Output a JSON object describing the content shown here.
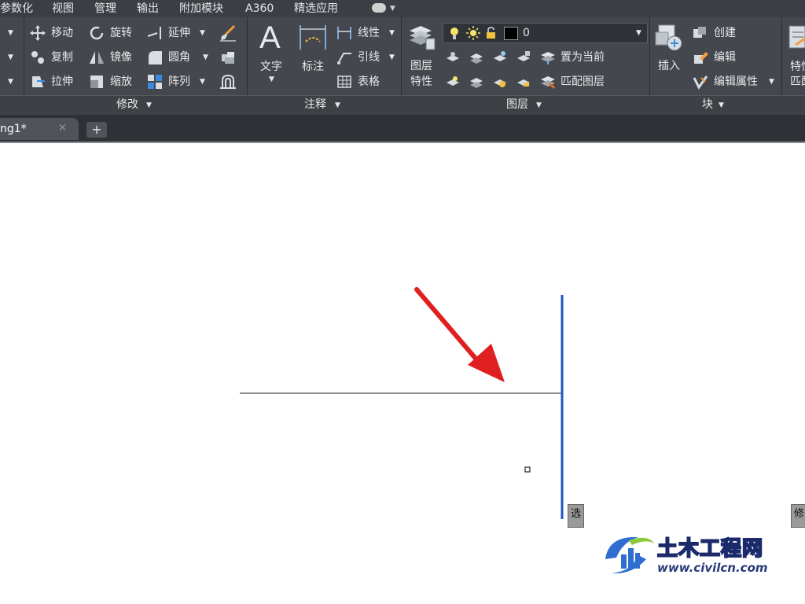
{
  "menu": {
    "items": [
      {
        "label": "参数化"
      },
      {
        "label": "视图"
      },
      {
        "label": "管理"
      },
      {
        "label": "输出"
      },
      {
        "label": "附加模块"
      },
      {
        "label": "A360"
      },
      {
        "label": "精选应用"
      }
    ]
  },
  "ribbon": {
    "modify": {
      "title": "修改",
      "move": "移动",
      "rotate": "旋转",
      "extend": "延伸",
      "copy": "复制",
      "mirror": "镜像",
      "fillet": "圆角",
      "stretch": "拉伸",
      "scale": "缩放",
      "array": "阵列"
    },
    "annotation": {
      "title": "注释",
      "text": "文字",
      "dimension": "标注",
      "linear": "线性",
      "leader": "引线",
      "table": "表格"
    },
    "layers": {
      "title": "图层",
      "properties_line1": "图层",
      "properties_line2": "特性",
      "current_layer": "0",
      "set_current": "置为当前",
      "match_layer": "匹配图层"
    },
    "block": {
      "title": "块",
      "insert": "插入",
      "create": "创建",
      "edit": "编辑",
      "edit_attributes": "编辑属性"
    },
    "properties": {
      "line1": "特性",
      "line2": "匹配"
    }
  },
  "tabs": {
    "drawing_label": "ng1*",
    "close_glyph": "×",
    "new_glyph": "+"
  },
  "canvas": {
    "tooltip_select": "选",
    "tooltip_modify": "修"
  },
  "watermark": {
    "name": "土木工程网",
    "url": "www.civilcn.com"
  },
  "colors": {
    "menubar_bg": "#3b3f45",
    "ribbon_bg": "#44474d",
    "arrow": "#e02020",
    "selected_line": "#1f56c8"
  }
}
